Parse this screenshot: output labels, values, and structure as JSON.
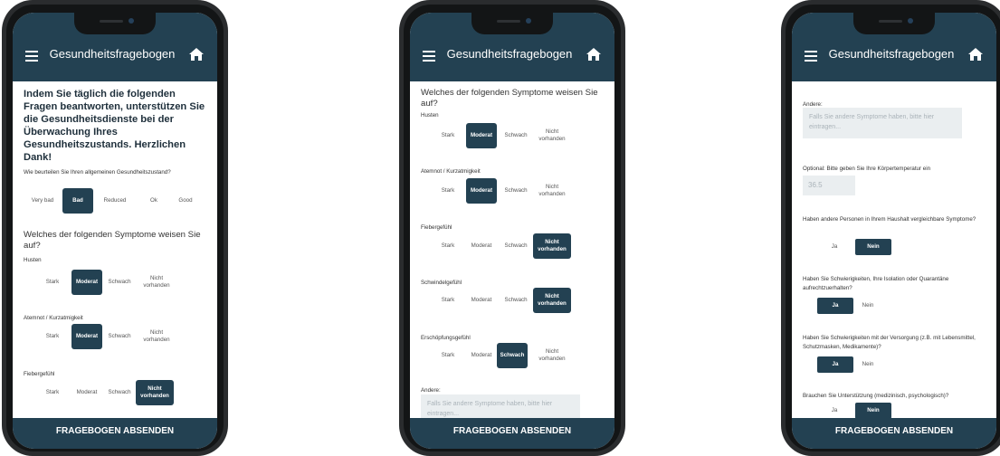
{
  "app": {
    "title": "Gesundheitsfragebogen",
    "submit": "FRAGEBOGEN ABSENDEN"
  },
  "icons": {
    "menu": "hamburger-menu-icon",
    "home": "home-icon"
  },
  "colors": {
    "primary": "#234152"
  },
  "screen1": {
    "intro": "Indem Sie täglich die folgenden Fragen beantworten, unterstützen Sie die Gesundheitsdienste bei der Überwachung Ihres Gesundheitszustands. Herzlichen Dank!",
    "state_question": "Wie beurteilen Sie Ihren allgemeinen Gesundheitszustand?",
    "state_options": [
      "Very bad",
      "Bad",
      "Reduced",
      "Ok",
      "Good"
    ],
    "state_selected": "Bad",
    "symptoms_heading": "Welches der folgenden Symptome weisen Sie auf?",
    "symptoms": [
      {
        "label": "Husten",
        "options": [
          "Stark",
          "Moderat",
          "Schwach",
          "Nicht vorhanden"
        ],
        "selected": "Moderat"
      },
      {
        "label": "Atemnot / Kurzatmigkeit",
        "options": [
          "Stark",
          "Moderat",
          "Schwach",
          "Nicht vorhanden"
        ],
        "selected": "Moderat"
      },
      {
        "label": "Fiebergefühl",
        "options": [
          "Stark",
          "Moderat",
          "Schwach",
          "Nicht vorhanden"
        ],
        "selected": "Nicht vorhanden"
      }
    ]
  },
  "screen2": {
    "symptoms_heading": "Welches der folgenden Symptome weisen Sie auf?",
    "symptoms": [
      {
        "label": "Husten",
        "options": [
          "Stark",
          "Moderat",
          "Schwach",
          "Nicht vorhanden"
        ],
        "selected": "Moderat"
      },
      {
        "label": "Atemnot / Kurzatmigkeit",
        "options": [
          "Stark",
          "Moderat",
          "Schwach",
          "Nicht vorhanden"
        ],
        "selected": "Moderat"
      },
      {
        "label": "Fiebergefühl",
        "options": [
          "Stark",
          "Moderat",
          "Schwach",
          "Nicht vorhanden"
        ],
        "selected": "Nicht vorhanden"
      },
      {
        "label": "Schwindelgefühl",
        "options": [
          "Stark",
          "Moderat",
          "Schwach",
          "Nicht vorhanden"
        ],
        "selected": "Nicht vorhanden"
      },
      {
        "label": "Erschöpfungsgefühl",
        "options": [
          "Stark",
          "Moderat",
          "Schwach",
          "Nicht vorhanden"
        ],
        "selected": "Schwach"
      }
    ],
    "other_label": "Andere:",
    "other_placeholder": "Falls Sie andere Symptome haben, bitte hier eintragen..."
  },
  "screen3": {
    "other_label": "Andere:",
    "other_placeholder": "Falls Sie andere Symptome haben, bitte hier eintragen...",
    "temp_label": "Optional: Bitte geben Sie Ihre Körpertemperatur ein",
    "temp_placeholder": "36.5",
    "questions": [
      {
        "text": "Haben andere Personen in Ihrem Haushalt vergleichbare Symptome?",
        "yes": "Ja",
        "no": "Nein",
        "selected": "Nein"
      },
      {
        "text": "Haben Sie Schwierigkeiten, Ihre Isolation oder Quarantäne aufrechtzuerhalten?",
        "yes": "Ja",
        "no": "Nein",
        "selected": "Ja"
      },
      {
        "text": "Haben Sie Schwierigkeiten mit der Versorgung (z.B. mit Lebensmittel, Schutzmasken, Medikamente)?",
        "yes": "Ja",
        "no": "Nein",
        "selected": "Ja"
      },
      {
        "text": "Brauchen Sie Unterstützung (medizinisch, psychologisch)?",
        "yes": "Ja",
        "no": "Nein",
        "selected": "Nein"
      }
    ]
  }
}
